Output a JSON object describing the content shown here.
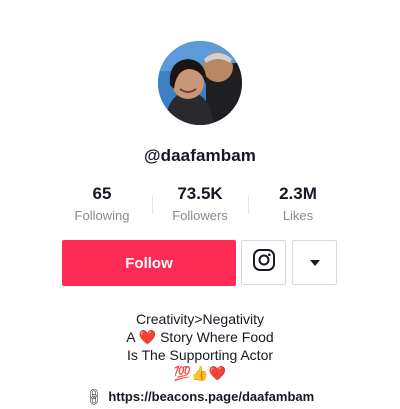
{
  "profile": {
    "username": "@daafambam",
    "avatar_alt": "profile photo of a couple"
  },
  "stats": [
    {
      "value": "65",
      "label": "Following"
    },
    {
      "value": "73.5K",
      "label": "Followers"
    },
    {
      "value": "2.3M",
      "label": "Likes"
    }
  ],
  "actions": {
    "follow_label": "Follow",
    "instagram_icon": "instagram-icon",
    "more_icon": "caret-down-icon"
  },
  "bio": {
    "line1": "Creativity>Negativity",
    "line2_pre": "A",
    "line2_heart": "❤️",
    "line2_post": "Story Where Food",
    "line3": "Is The Supporting Actor",
    "line4": "💯👍❤️"
  },
  "link": {
    "icon": "link-icon",
    "text": "https://beacons.page/daafambam"
  },
  "colors": {
    "accent": "#fe2c55",
    "text": "#161823",
    "muted": "#8a8b91"
  }
}
